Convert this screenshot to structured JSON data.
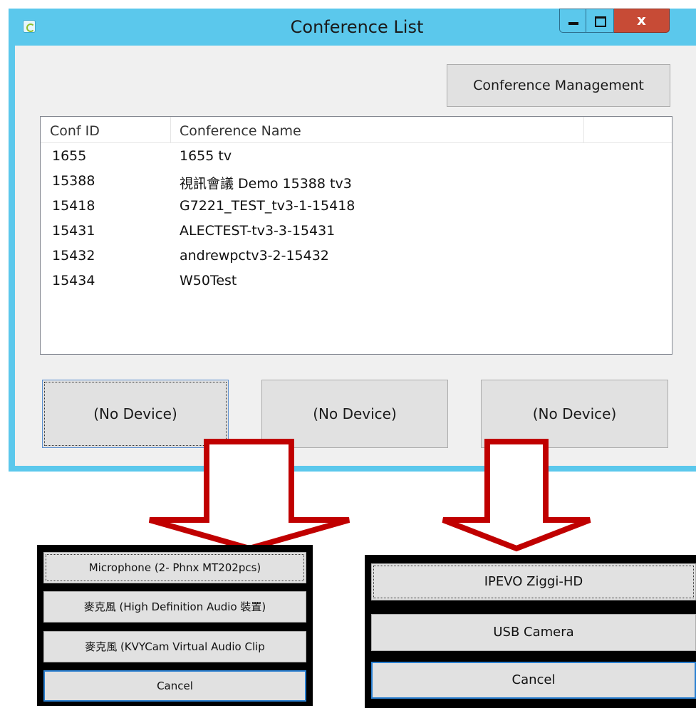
{
  "window": {
    "title": "Conference List",
    "close_label": "x",
    "management_button": "Conference Management"
  },
  "list": {
    "columns": [
      "Conf ID",
      "Conference Name"
    ],
    "rows": [
      {
        "id": "1655",
        "name": "1655 tv"
      },
      {
        "id": "15388",
        "name": "視訊會議 Demo 15388 tv3"
      },
      {
        "id": "15418",
        "name": "G7221_TEST_tv3-1-15418"
      },
      {
        "id": "15431",
        "name": "ALECTEST-tv3-3-15431"
      },
      {
        "id": "15432",
        "name": "andrewpctv3-2-15432"
      },
      {
        "id": "15434",
        "name": "W50Test"
      }
    ]
  },
  "devices": {
    "buttons": [
      "(No Device)",
      "(No Device)",
      "(No Device)"
    ]
  },
  "microphone_menu": {
    "options": [
      "Microphone (2- Phnx MT202pcs)",
      "麥克風 (High Definition Audio 裝置)",
      "麥克風 (KVYCam Virtual Audio Clip"
    ],
    "cancel": "Cancel"
  },
  "camera_menu": {
    "options": [
      "IPEVO Ziggi-HD",
      "USB Camera"
    ],
    "cancel": "Cancel"
  },
  "colors": {
    "title_bar": "#5bc8ec",
    "close_button": "#c74b36",
    "arrow": "#c00000"
  }
}
